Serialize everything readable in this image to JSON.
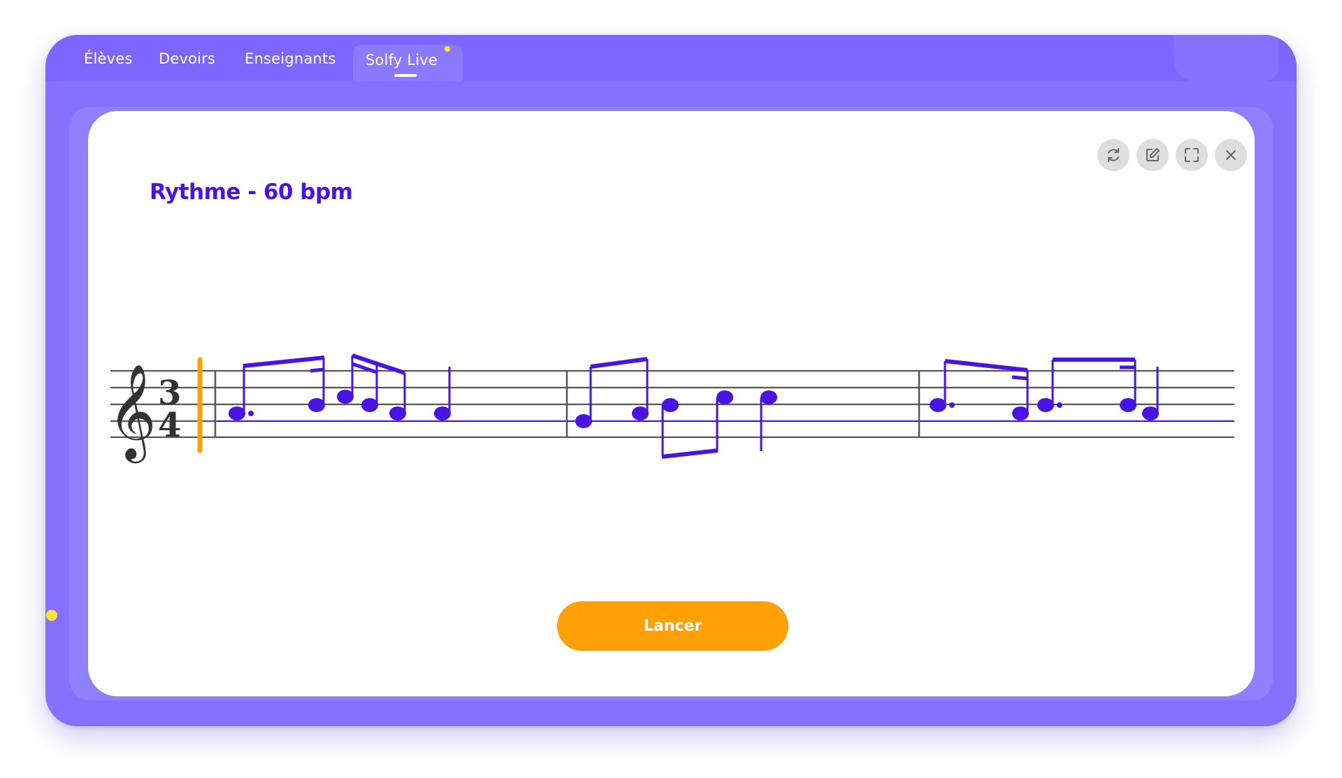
{
  "tabs": [
    {
      "label": "Élèves"
    },
    {
      "label": "Devoirs"
    },
    {
      "label": "Enseignants"
    },
    {
      "label": "Solfy Live",
      "active": true
    }
  ],
  "exercise": {
    "title": "Rythme - 60 bpm",
    "clef": "treble-clef",
    "time_signature": {
      "top": "3",
      "bottom": "4"
    },
    "controls": [
      {
        "name": "refresh-icon"
      },
      {
        "name": "edit-icon"
      },
      {
        "name": "fullscreen-icon"
      },
      {
        "name": "close-icon"
      }
    ],
    "launch_label": "Lancer"
  },
  "colors": {
    "brand_purple": "#7b66ff",
    "note_color": "#4a14e0",
    "cursor_orange": "#ffa106",
    "accent_yellow": "#ffe23a"
  }
}
